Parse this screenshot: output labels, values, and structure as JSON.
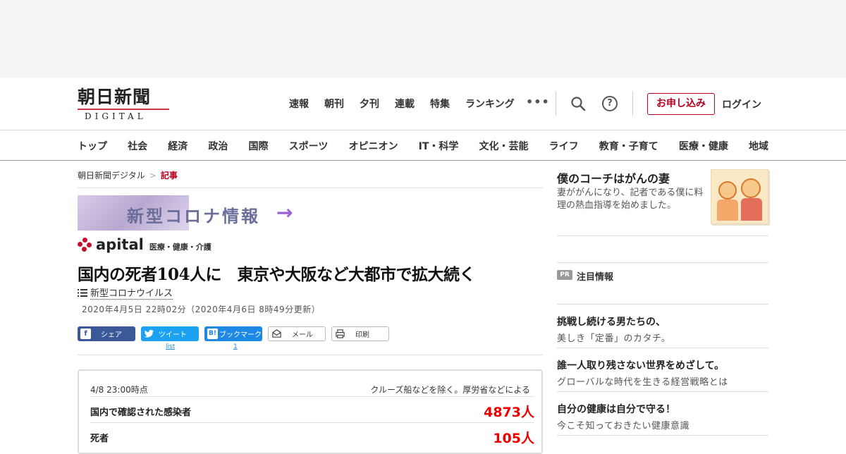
{
  "header": {
    "logo_main": "朝日新聞",
    "logo_sub": "DIGITAL",
    "top_nav": [
      "速報",
      "朝刊",
      "夕刊",
      "連載",
      "特集",
      "ランキング"
    ],
    "more": "•••",
    "help": "?",
    "subscribe_label": "お申し込み",
    "login_label": "ログイン"
  },
  "categories": [
    "トップ",
    "社会",
    "経済",
    "政治",
    "国際",
    "スポーツ",
    "オピニオン",
    "IT・科学",
    "文化・芸能",
    "ライフ",
    "教育・子育て",
    "医療・健康",
    "地域"
  ],
  "breadcrumb": {
    "home": "朝日新聞デジタル",
    "sep": ">",
    "current": "記事"
  },
  "banner": {
    "text": "新型コロナ情報",
    "arrow": "→"
  },
  "apital": {
    "word": "apital",
    "sub": "医療・健康・介護"
  },
  "article": {
    "title": "国内の死者104人に　東京や大阪など大都市で拡大続く",
    "topic": "新型コロナウイルス",
    "date": "2020年4月5日 22時02分（2020年4月6日 8時49分更新）"
  },
  "share": {
    "facebook": "シェア",
    "twitter": "ツイート",
    "twitter_count": "list",
    "bookmark": "ブックマーク",
    "bookmark_count": "1",
    "mail": "メール",
    "print": "印刷"
  },
  "stats": {
    "as_of": "4/8 23:00時点",
    "note": "クルーズ船などを除く。厚労省などによる",
    "rows": [
      {
        "label": "国内で確認された感染者",
        "value": "4873人"
      },
      {
        "label": "死者",
        "value": "105人"
      }
    ]
  },
  "sidebar": {
    "promo_title": "僕のコーチはがんの妻",
    "promo_desc": "妻ががんになり、記者である僕に料理の熱血指導を始めました。",
    "pr_badge": "PR",
    "pr_title": "注目情報",
    "pr_items": [
      {
        "title": "挑戦し続ける男たちの、",
        "desc": "美しき「定番」のカタチ。"
      },
      {
        "title": "誰一人取り残さない世界をめざして。",
        "desc": "グローバルな時代を生きる経営戦略とは"
      },
      {
        "title": "自分の健康は自分で守る！",
        "desc": "今こそ知っておきたい健康意識"
      }
    ]
  },
  "colors": {
    "brand_red": "#b7001d",
    "stat_red": "#ee0000",
    "facebook": "#3b5998",
    "twitter": "#1da1f2"
  }
}
